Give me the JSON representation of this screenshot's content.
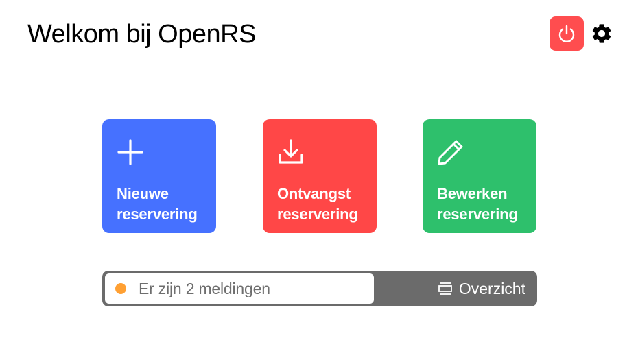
{
  "header": {
    "title": "Welkom bij OpenRS",
    "power_icon": "power-icon",
    "settings_icon": "gear-icon",
    "power_color": "#ff4d4f"
  },
  "tiles": [
    {
      "icon": "plus-icon",
      "line1": "Nieuwe",
      "line2": "reservering",
      "color": "#4671ff"
    },
    {
      "icon": "download-icon",
      "line1": "Ontvangst",
      "line2": "reservering",
      "color": "#ff4747"
    },
    {
      "icon": "pencil-icon",
      "line1": "Bewerken",
      "line2": "reservering",
      "color": "#2ec06c"
    }
  ],
  "notifications": {
    "message": "Er zijn 2 meldingen",
    "status_color": "#ffa033",
    "overview_label": "Overzicht",
    "overview_icon": "list-icon",
    "bar_color": "#6b6b6b"
  }
}
